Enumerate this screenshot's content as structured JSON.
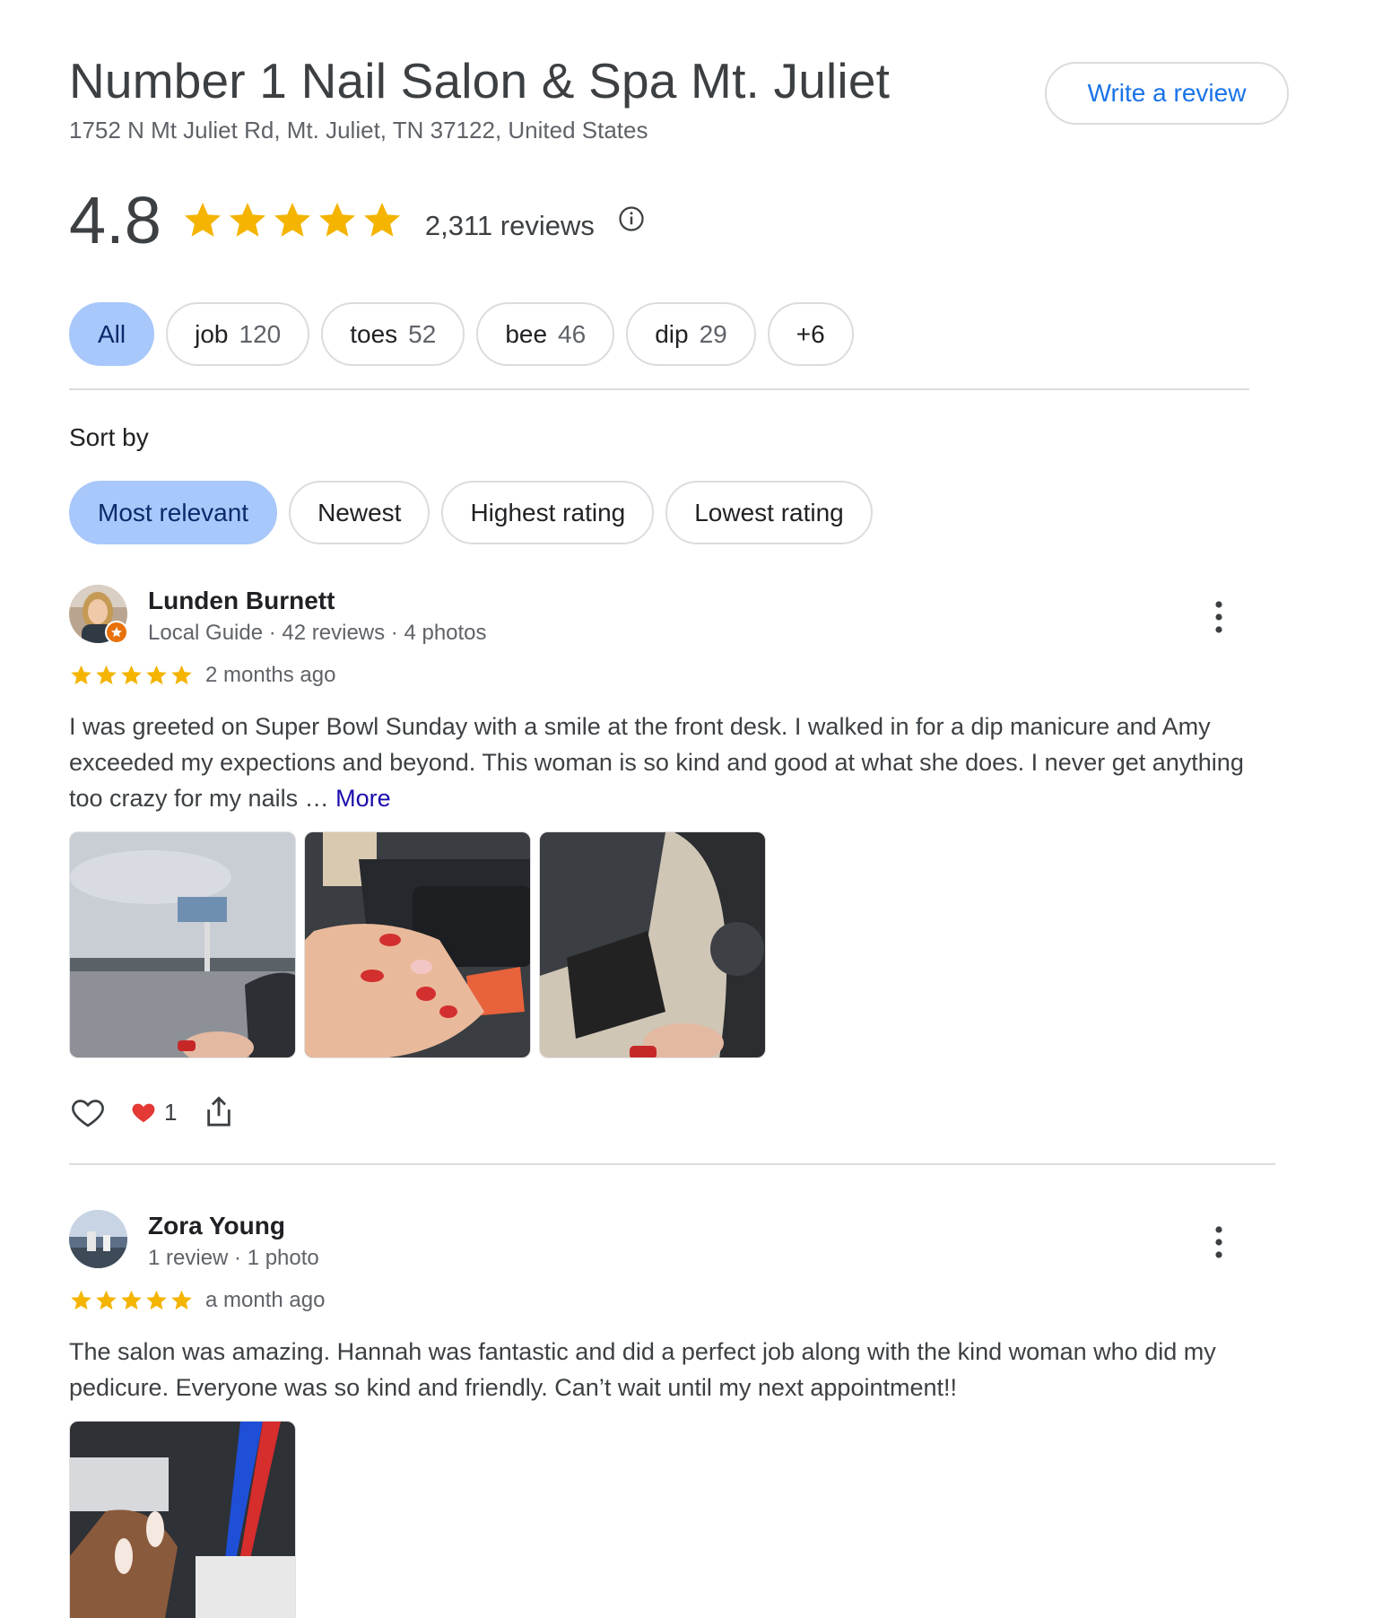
{
  "header": {
    "title": "Number 1 Nail Salon & Spa Mt. Juliet",
    "address": "1752 N Mt Juliet Rd, Mt. Juliet, TN 37122, United States",
    "write_review_label": "Write a review"
  },
  "summary": {
    "rating": "4.8",
    "stars": 5,
    "review_count": "2,311 reviews",
    "star_color": "#f4b400"
  },
  "topics": [
    {
      "label": "All",
      "count": ""
    },
    {
      "label": "job",
      "count": "120"
    },
    {
      "label": "toes",
      "count": "52"
    },
    {
      "label": "bee",
      "count": "46"
    },
    {
      "label": "dip",
      "count": "29"
    },
    {
      "label": "+6",
      "count": ""
    }
  ],
  "sort": {
    "label": "Sort by",
    "options": [
      "Most relevant",
      "Newest",
      "Highest rating",
      "Lowest rating"
    ],
    "selected": "Most relevant"
  },
  "reviews": [
    {
      "name": "Lunden Burnett",
      "meta": "Local Guide · 42 reviews · 4 photos",
      "stars": 5,
      "time": "2 months ago",
      "text": "I was greeted on Super Bowl Sunday with a smile at the front desk. I walked in for a dip manicure and Amy exceeded my expections and beyond. This woman is so kind and good at what she does. I never get anything too crazy for my nails … ",
      "more_label": "More",
      "reaction_count": "1"
    },
    {
      "name": "Zora Young",
      "meta": "1 review · 1 photo",
      "stars": 5,
      "time": "a month ago",
      "text": "The salon was amazing. Hannah was fantastic and did a perfect job along with the kind woman who did my pedicure. Everyone was so kind and friendly. Can’t wait until my next appointment!!"
    }
  ],
  "icons": {
    "star": "star-icon",
    "info": "info-icon",
    "menu": "more-vert-icon",
    "like": "heart-outline-icon",
    "reaction": "heart-emoji-icon",
    "share": "share-icon"
  }
}
